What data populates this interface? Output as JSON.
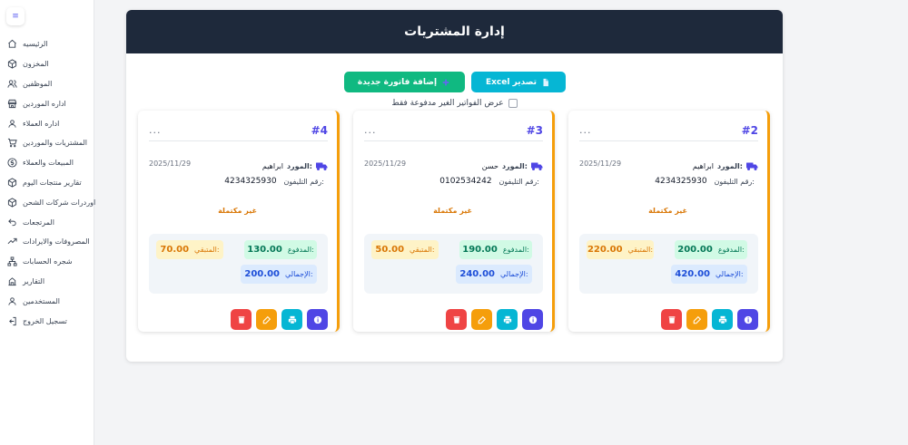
{
  "sidebar": {
    "toggle_icon": "hamburger-icon",
    "items": [
      {
        "label": "الرئيسيه",
        "icon": "home-icon"
      },
      {
        "label": "المخزون",
        "icon": "box-icon"
      },
      {
        "label": "الموظفين",
        "icon": "users-icon"
      },
      {
        "label": "اداره الموردين",
        "icon": "store-icon"
      },
      {
        "label": "اداره العملاء",
        "icon": "user-icon"
      },
      {
        "label": "المشتريات والموردين",
        "icon": "cart-icon"
      },
      {
        "label": "المبيعات والعملاء",
        "icon": "dollar-icon"
      },
      {
        "label": "تقارير منتجات اليوم",
        "icon": "box-icon"
      },
      {
        "label": "اوردرات شركات الشحن",
        "icon": "box-icon"
      },
      {
        "label": "المرتجعات",
        "icon": "return-icon"
      },
      {
        "label": "المصروفات والايرادات",
        "icon": "trend-icon"
      },
      {
        "label": "شجره الحسابات",
        "icon": "tree-icon"
      },
      {
        "label": "التقارير",
        "icon": "report-icon"
      },
      {
        "label": "المستخدمين",
        "icon": "user-icon"
      },
      {
        "label": "تسجيل الخروج",
        "icon": "logout-icon"
      }
    ]
  },
  "page": {
    "title": "إدارة المشتريات",
    "add_button": "إضافة فاتورة جديدة",
    "excel_button": "Excel تصدير",
    "filter_label": "عرض الفواتير الغير مدفوعة فقط"
  },
  "labels": {
    "supplier": "المورد:",
    "phone": "رقم التليفون:",
    "paid": "المدفوع:",
    "remaining": "المتبقي:",
    "total": "الإجمالي:",
    "dots": "..."
  },
  "invoices": [
    {
      "number": "#2",
      "supplier": "ابراهيم",
      "date": "2025/11/29",
      "phone": "4234325930",
      "status": "غير مكتملة",
      "paid": "200.00",
      "remaining": "220.00",
      "total": "420.00"
    },
    {
      "number": "#3",
      "supplier": "حسن",
      "date": "2025/11/29",
      "phone": "0102534242",
      "status": "غير مكتملة",
      "paid": "190.00",
      "remaining": "50.00",
      "total": "240.00"
    },
    {
      "number": "#4",
      "supplier": "ابراهيم",
      "date": "2025/11/29",
      "phone": "4234325930",
      "status": "غير مكتملة",
      "paid": "130.00",
      "remaining": "70.00",
      "total": "200.00"
    }
  ],
  "colors": {
    "header": "#1e293b",
    "accent": "#4f46e5",
    "add": "#10b981",
    "excel": "#06b6d4",
    "card_border": "#f59e0b",
    "delete": "#ef4444"
  }
}
